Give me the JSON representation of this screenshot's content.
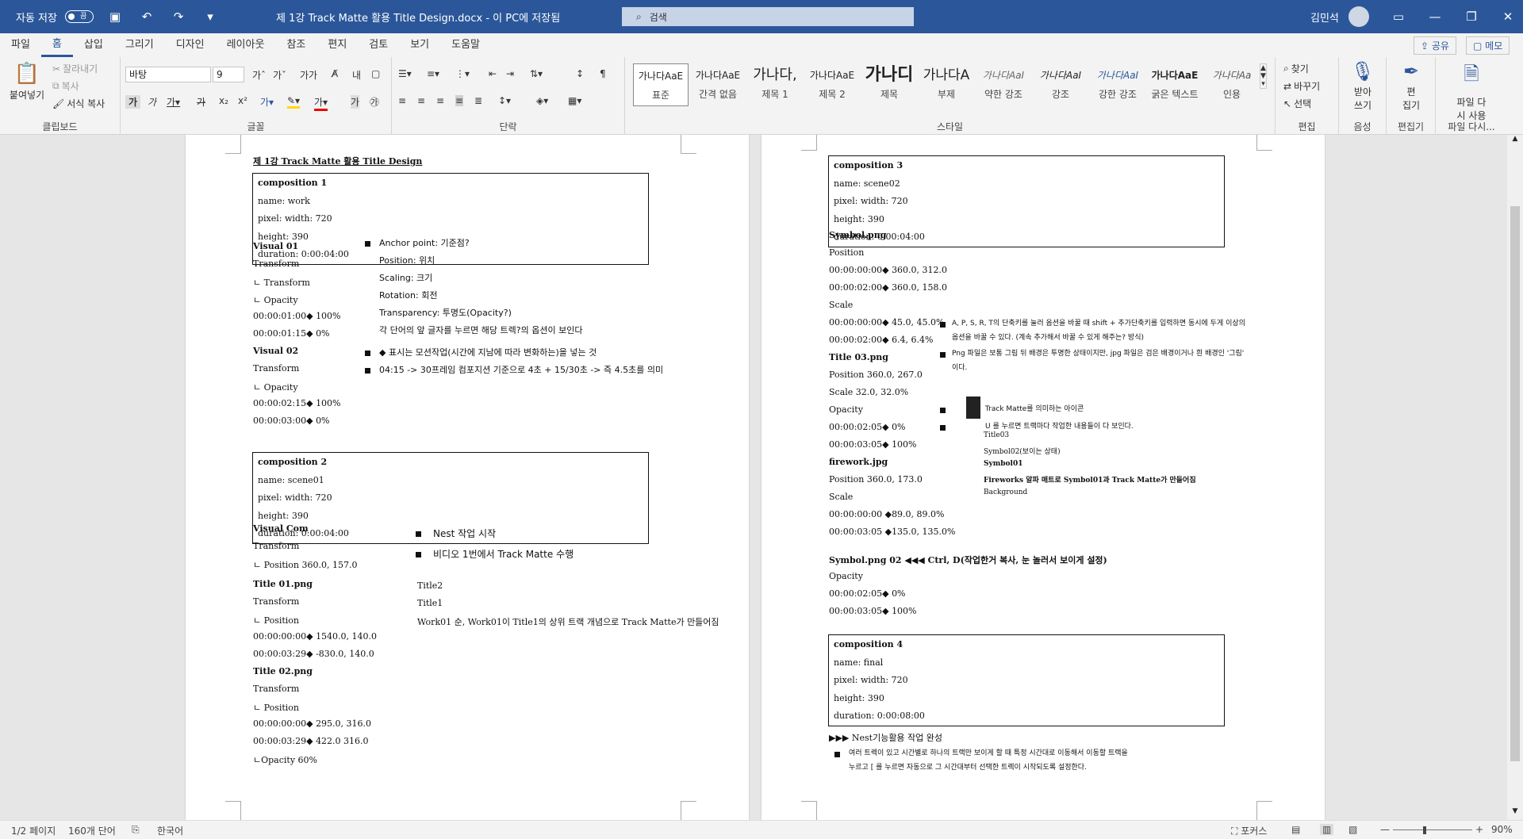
{
  "titlebar": {
    "autosave_label": "자동 저장",
    "toggle_state": "끔",
    "document_title": "제 1강 Track Matte 활용 Title Design.docx - 이 PC에 저장됨",
    "search_placeholder": "검색",
    "user_name": "김민석"
  },
  "tabs": [
    "파일",
    "홈",
    "삽입",
    "그리기",
    "디자인",
    "레이아웃",
    "참조",
    "편지",
    "검토",
    "보기",
    "도움말"
  ],
  "share_label": "공유",
  "memo_label": "메모",
  "clipboard": {
    "paste": "붙여넣기",
    "cut": "잘라내기",
    "copy": "복사",
    "format_painter": "서식 복사",
    "label": "클립보드"
  },
  "font": {
    "name": "바탕",
    "size": "9",
    "label": "글꼴"
  },
  "paragraph": {
    "label": "단락"
  },
  "styles": {
    "label": "스타일",
    "items": [
      {
        "preview": "가나다AaE",
        "name": "표준"
      },
      {
        "preview": "가나다AaE",
        "name": "간격 없음"
      },
      {
        "preview": "가나다,",
        "name": "제목 1"
      },
      {
        "preview": "가나다AaE",
        "name": "제목 2"
      },
      {
        "preview": "가나디",
        "name": "제목"
      },
      {
        "preview": "가나다A",
        "name": "부제"
      },
      {
        "preview": "가나다AaI",
        "name": "약한 강조"
      },
      {
        "preview": "가나다AaI",
        "name": "강조"
      },
      {
        "preview": "가나다AaI",
        "name": "강한 강조"
      },
      {
        "preview": "가나다AaE",
        "name": "굵은 텍스트"
      },
      {
        "preview": "가나다Aa",
        "name": "인용"
      }
    ]
  },
  "editing": {
    "find": "찾기",
    "replace": "바꾸기",
    "select": "선택",
    "label": "편집"
  },
  "voice": {
    "dictate": "받아\n쓰기",
    "label": "음성"
  },
  "editor": {
    "name": "편\n집기",
    "label": "편집기"
  },
  "reuse": {
    "name": "파일 다\n시 사용",
    "label": "파일 다시..."
  },
  "page1": {
    "title": "제 1강 Track Matte 활용 Title Design",
    "comp1": [
      "composition 1",
      "name: work",
      "pixel: width: 720",
      "height: 390",
      "duration: 0:00:04:00"
    ],
    "left": [
      "Visual 01",
      "Transform",
      "ㄴ Transform",
      "ㄴ Opacity",
      "00:00:01:00◆ 100%",
      "00:00:01:15◆ 0%",
      "Visual 02",
      "Transform",
      "ㄴ Opacity",
      "00:00:02:15◆ 100%",
      "00:00:03:00◆ 0%"
    ],
    "right": [
      "Anchor point: 기준점?",
      "Position: 위치",
      "Scaling: 크기",
      "Rotation: 회전",
      "Transparency: 투명도(Opacity?)",
      "각 단어의 앞 글자를 누르면 해당 트렉?의 옵션이 보인다",
      "◆ 표시는 모션작업(시간에 지남에 따라 변화하는)을 넣는 것",
      "04:15 -> 30프레임 컴포지션 기준으로 4초 + 15/30초 -> 즉 4.5초를 의미"
    ],
    "comp2": [
      "composition 2",
      "name: scene01",
      "pixel: width: 720",
      "height: 390",
      "duration: 0:00:04:00"
    ],
    "left2": [
      "Visual Com",
      "Transform",
      "ㄴ Position 360.0, 157.0",
      "Title 01.png",
      "Transform",
      "ㄴ Position",
      "00:00:00:00◆ 1540.0, 140.0",
      "00:00:03:29◆ -830.0, 140.0",
      "Title 02.png",
      "Transform",
      "ㄴ Position",
      "00:00:00:00◆ 295.0, 316.0",
      "00:00:03:29◆ 422.0 316.0",
      "ㄴOpacity 60%"
    ],
    "right2": [
      "Nest 작업 시작",
      "비디오 1번에서 Track Matte 수행",
      "Title2",
      "Title1",
      "Work01 순, Work01이 Title1의 상위 트랙 개념으로 Track Matte가 만들어짐"
    ]
  },
  "page2": {
    "comp3": [
      "composition 3",
      "name: scene02",
      "pixel: width: 720",
      "height: 390",
      "duration: 0:00:04:00"
    ],
    "left": [
      "Symbol.png",
      "Position",
      "00:00:00:00◆ 360.0, 312.0",
      "00:00:02:00◆ 360.0, 158.0",
      "Scale",
      "00:00:00:00◆ 45.0, 45.0%",
      "00:00:02:00◆ 6.4, 6.4%",
      "Title 03.png",
      "Position 360.0, 267.0",
      "Scale 32.0, 32.0%",
      "Opacity",
      "00:00:02:05◆ 0%",
      "00:00:03:05◆ 100%",
      "firework.jpg",
      "Position 360.0, 173.0",
      "Scale",
      "00:00:00:00 ◆89.0, 89.0%",
      "00:00:03:05 ◆135.0, 135.0%",
      "Symbol.png 02 ◀◀◀ Ctrl, D(작업한거 복사, 눈 놀러서 보이게 설정)",
      "Opacity",
      "00:00:02:05◆ 0%",
      "00:00:03:05◆ 100%"
    ],
    "notes": [
      "A, P, S, R, T의 단축키를 눌러 옵션을 바꿀 때 shift + 추가단축키를 입력하면 동시에 두게 이상의",
      "옵션을 바꿀 수 있다. (계속 추가해서 바꿀 수 있게 해주는? 방식)",
      "Png 파일은 보통 그림 뒤 배경은 투명한 상태이지만, jpg 파일은 검은 배경이거나 흰 배경인 '그림'",
      "이다.",
      "Track Matte를 의미하는 아이콘",
      "U 를 누르면 트랙마다 작업한 내용들이 다 보인다."
    ],
    "layers": [
      "Title03",
      "Symbol02(보이는 상태)",
      "Symbol01",
      "Fireworks 알파 매트로 Symbol01과 Track Matte가 만들어짐",
      "Background"
    ],
    "comp4": [
      "composition 4",
      "name: final",
      "pixel: width: 720",
      "height: 390",
      "duration: 0:00:08:00"
    ],
    "done": "▶▶▶ Nest기능활용 작업 완성",
    "final_note": [
      "여러 트렉이 있고 시간별로 하나의 트랙만 보이게 할 때 특정 시간대로 이동해서 이동할 트랙을",
      "누르고 [ 를 누르면 자동으로 그 시간대부터 선택한 트렉이 시작되도록 설정한다."
    ]
  },
  "status": {
    "page": "1/2 페이지",
    "words": "160개 단어",
    "language": "한국어",
    "focus": "포커스",
    "zoom": "90%"
  }
}
